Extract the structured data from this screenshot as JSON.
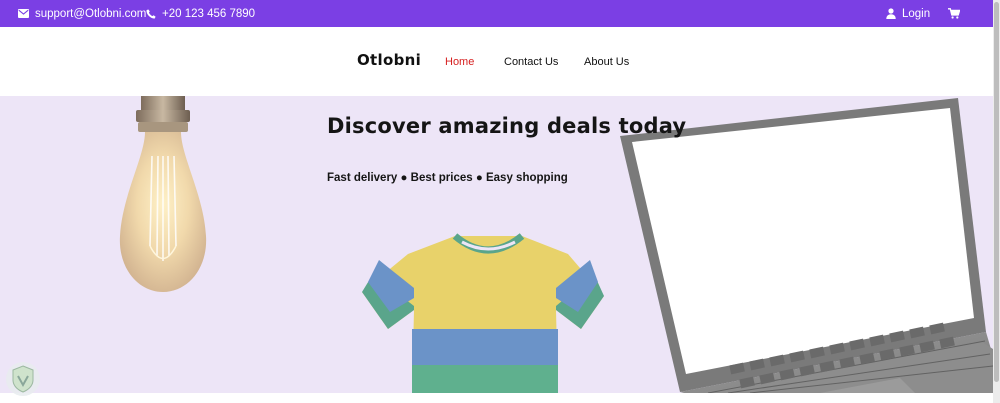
{
  "topbar": {
    "email": "support@Otlobni.com",
    "phone": "+20 123 456 7890",
    "login": "Login",
    "icons": {
      "email": "envelope-icon",
      "phone": "phone-icon",
      "login": "user-icon",
      "cart": "cart-icon"
    },
    "background": "#7b3fe4"
  },
  "navbar": {
    "brand": "Otlobni",
    "links": [
      {
        "label": "Home",
        "active": true
      },
      {
        "label": "Contact Us",
        "active": false
      },
      {
        "label": "About Us",
        "active": false
      }
    ],
    "active_color": "#d62020"
  },
  "hero": {
    "title": "Discover amazing deals today",
    "subtitle": "Fast delivery ● Best prices ● Easy shopping",
    "background": "#ede5f7"
  }
}
